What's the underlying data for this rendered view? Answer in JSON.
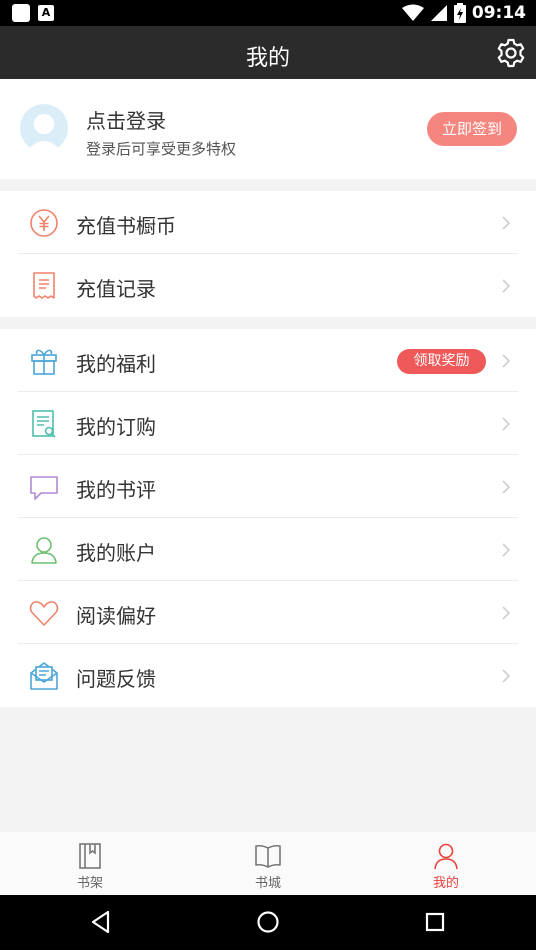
{
  "status_bar": {
    "time": "09:14",
    "notif_letter": "A"
  },
  "header": {
    "title": "我的"
  },
  "profile": {
    "title": "点击登录",
    "subtitle": "登录后可享受更多特权",
    "signin_label": "立即签到"
  },
  "menu_group_1": [
    {
      "label": "充值书橱币",
      "icon": "yen-icon"
    },
    {
      "label": "充值记录",
      "icon": "receipt-icon"
    }
  ],
  "menu_group_2": [
    {
      "label": "我的福利",
      "icon": "gift-icon",
      "badge": "领取奖励"
    },
    {
      "label": "我的订购",
      "icon": "order-list-icon"
    },
    {
      "label": "我的书评",
      "icon": "comment-icon"
    },
    {
      "label": "我的账户",
      "icon": "user-icon"
    },
    {
      "label": "阅读偏好",
      "icon": "heart-icon"
    },
    {
      "label": "问题反馈",
      "icon": "mail-icon"
    }
  ],
  "tabbar": {
    "items": [
      {
        "label": "书架",
        "icon": "bookshelf-icon"
      },
      {
        "label": "书城",
        "icon": "open-book-icon"
      },
      {
        "label": "我的",
        "icon": "user-icon",
        "active": true
      }
    ]
  },
  "colors": {
    "accent": "#e8453c",
    "signin_button": "#f5867f",
    "badge": "#f0595a",
    "titlebar": "#2b2b2b"
  }
}
